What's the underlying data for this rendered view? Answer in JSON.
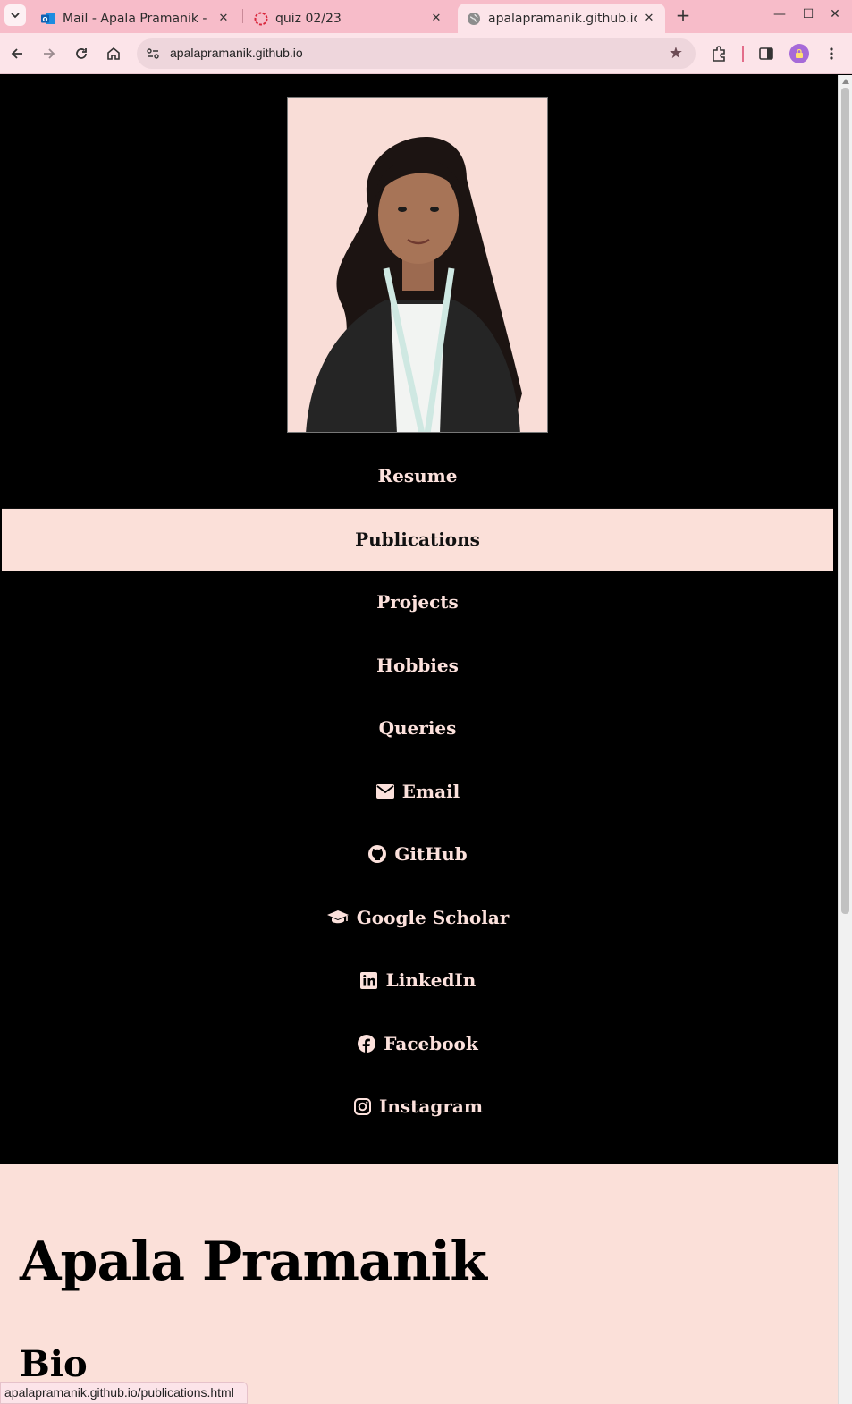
{
  "browser": {
    "tabs": [
      {
        "title": "Mail - Apala Pramanik - Outlook",
        "icon": "outlook-icon",
        "active": false
      },
      {
        "title": "quiz 02/23",
        "icon": "quiz-icon",
        "active": false
      },
      {
        "title": "apalapramanik.github.io",
        "icon": "globe-icon",
        "active": true
      }
    ],
    "address": "apalapramanik.github.io",
    "status_url": "apalapramanik.github.io/publications.html"
  },
  "sidebar": {
    "portrait_alt": "Apala Pramanik",
    "nav": [
      {
        "label": "Resume",
        "icon": ""
      },
      {
        "label": "Publications",
        "icon": "",
        "active": true
      },
      {
        "label": "Projects",
        "icon": ""
      },
      {
        "label": "Hobbies",
        "icon": ""
      },
      {
        "label": "Queries",
        "icon": ""
      },
      {
        "label": "Email",
        "icon": "envelope-icon"
      },
      {
        "label": "GitHub",
        "icon": "github-icon"
      },
      {
        "label": "Google Scholar",
        "icon": "graduation-cap-icon"
      },
      {
        "label": "LinkedIn",
        "icon": "linkedin-icon"
      },
      {
        "label": "Facebook",
        "icon": "facebook-icon"
      },
      {
        "label": "Instagram",
        "icon": "instagram-icon"
      }
    ]
  },
  "main": {
    "name": "Apala Pramanik",
    "section_heading": "Bio"
  },
  "colors": {
    "tabbar": "#f7bcc9",
    "toolbar": "#fce4e9",
    "sidebar_bg": "#000000",
    "accent_pink": "#fbe0d9",
    "nav_text": "#fce1dc"
  }
}
